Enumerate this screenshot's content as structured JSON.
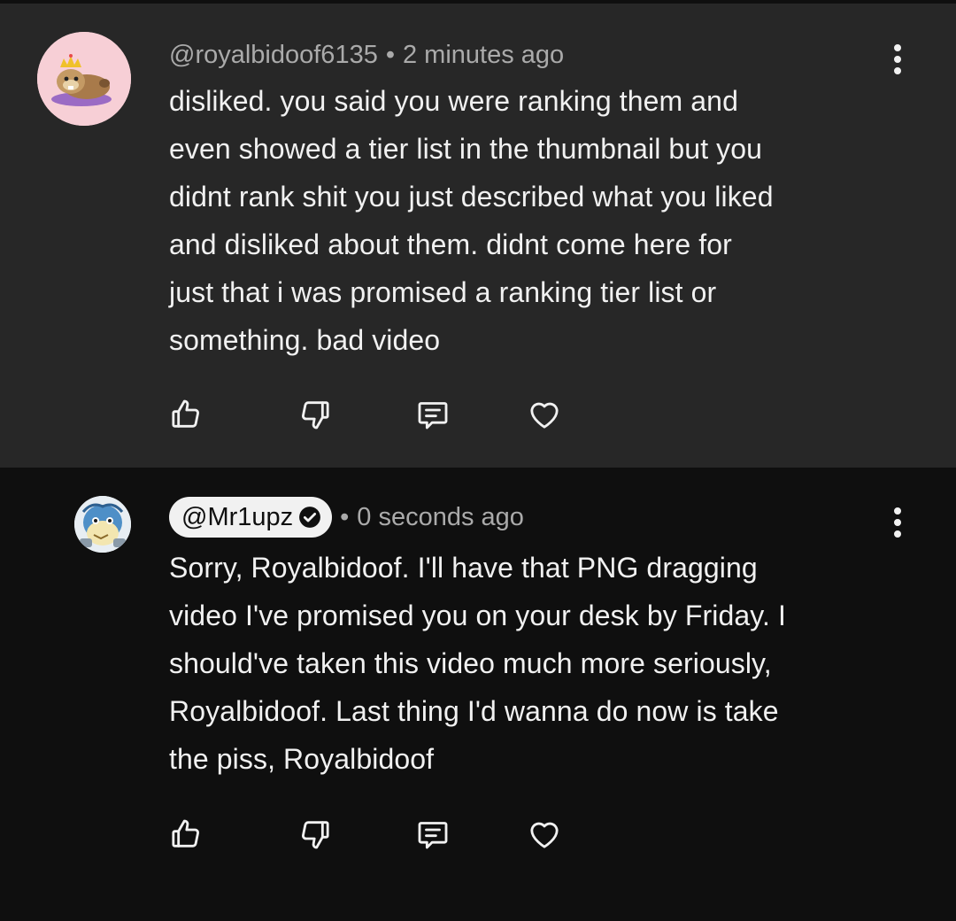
{
  "comments": [
    {
      "author": "@royalbidoof6135",
      "separator": "•",
      "time": "2 minutes ago",
      "lines": [
        "disliked. you said you were ranking them and",
        "even showed a tier list in the thumbnail but you",
        "didnt rank shit you just described what you liked",
        "and disliked about them. didnt come here for",
        "just that i was promised a ranking tier list or",
        "something. bad video"
      ],
      "avatar_icon": "bidoof-with-crown-avatar",
      "actions": [
        "thumbs-up-icon",
        "thumbs-down-icon",
        "reply-icon",
        "heart-icon"
      ]
    },
    {
      "author": "@Mr1upz",
      "verified_icon": "verified-check-icon",
      "separator": "•",
      "time": "0 seconds ago",
      "lines": [
        "Sorry, Royalbidoof. I'll have that PNG dragging",
        "video I've promised you on your desk by Friday. I",
        "should've taken this video much more seriously,",
        "Royalbidoof. Last thing I'd wanna do now is take",
        "the piss, Royalbidoof"
      ],
      "avatar_icon": "pokemon-character-avatar",
      "actions": [
        "thumbs-up-icon",
        "thumbs-down-icon",
        "reply-icon",
        "heart-icon"
      ]
    }
  ],
  "colors": {
    "background": "#0f0f0f",
    "highlighted_comment": "#272727",
    "meta_text": "#aaaaaa",
    "body_text": "#f1f1f1"
  }
}
